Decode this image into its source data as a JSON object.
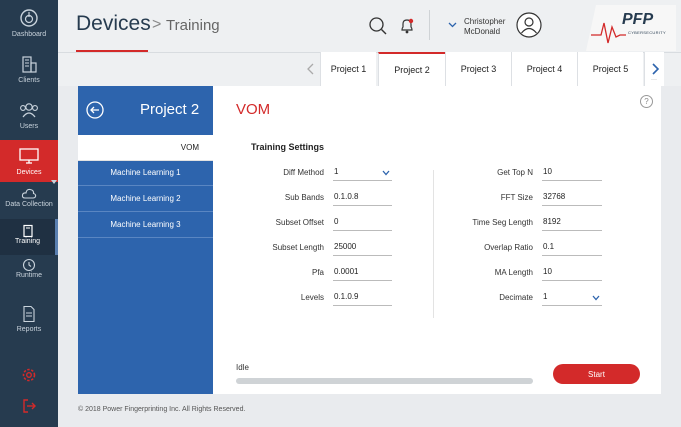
{
  "nav": {
    "items": [
      {
        "label": "Dashboard",
        "icon": "dashboard-icon"
      },
      {
        "label": "Clients",
        "icon": "building-icon"
      },
      {
        "label": "Users",
        "icon": "users-icon"
      },
      {
        "label": "Devices",
        "icon": "monitor-icon"
      },
      {
        "label": "Data Collection",
        "icon": "cloud-icon"
      },
      {
        "label": "Training",
        "icon": "book-icon"
      },
      {
        "label": "Runtime",
        "icon": "history-icon"
      },
      {
        "label": "Reports",
        "icon": "document-icon"
      }
    ],
    "active": "Devices",
    "active_sub": "Training"
  },
  "header": {
    "title": "Devices",
    "separator": ">",
    "subtitle": "Training",
    "user_first": "Christopher",
    "user_last": "McDonald",
    "logo_text": "PFP",
    "logo_sub": "CYBERSECURITY"
  },
  "tabs": [
    "Project 1",
    "Project 2",
    "Project 3",
    "Project 4",
    "Project 5"
  ],
  "active_tab": "Project 2",
  "project": {
    "title": "Project 2",
    "items": [
      "VOM",
      "Machine Learning 1",
      "Machine Learning 2",
      "Machine Learning 3"
    ],
    "active": "VOM"
  },
  "main": {
    "title": "VOM",
    "help": "?",
    "section_title": "Training Settings",
    "left_fields": [
      {
        "label": "Diff Method",
        "value": "1"
      },
      {
        "label": "Sub Bands",
        "value": "0.1.0.8"
      },
      {
        "label": "Subset  Offset",
        "value": "0"
      },
      {
        "label": "Subset Length",
        "value": "25000"
      },
      {
        "label": "Pfa",
        "value": "0.0001"
      },
      {
        "label": "Levels",
        "value": "0.1.0.9"
      }
    ],
    "right_fields": [
      {
        "label": "Get Top N",
        "value": "10"
      },
      {
        "label": "FFT Size",
        "value": "32768"
      },
      {
        "label": "Time Seg Length",
        "value": "8192"
      },
      {
        "label": "Overlap Ratio",
        "value": "0.1"
      },
      {
        "label": "MA Length",
        "value": "10"
      },
      {
        "label": "Decimate",
        "value": "1"
      }
    ],
    "status": "Idle",
    "progress": 0,
    "start_label": "Start"
  },
  "footer": "© 2018 Power Fingerprinting Inc. All Rights Reserved.",
  "colors": {
    "accent": "#d32a2a",
    "nav_bg": "#263b4f",
    "project_blue": "#2d64ad"
  }
}
